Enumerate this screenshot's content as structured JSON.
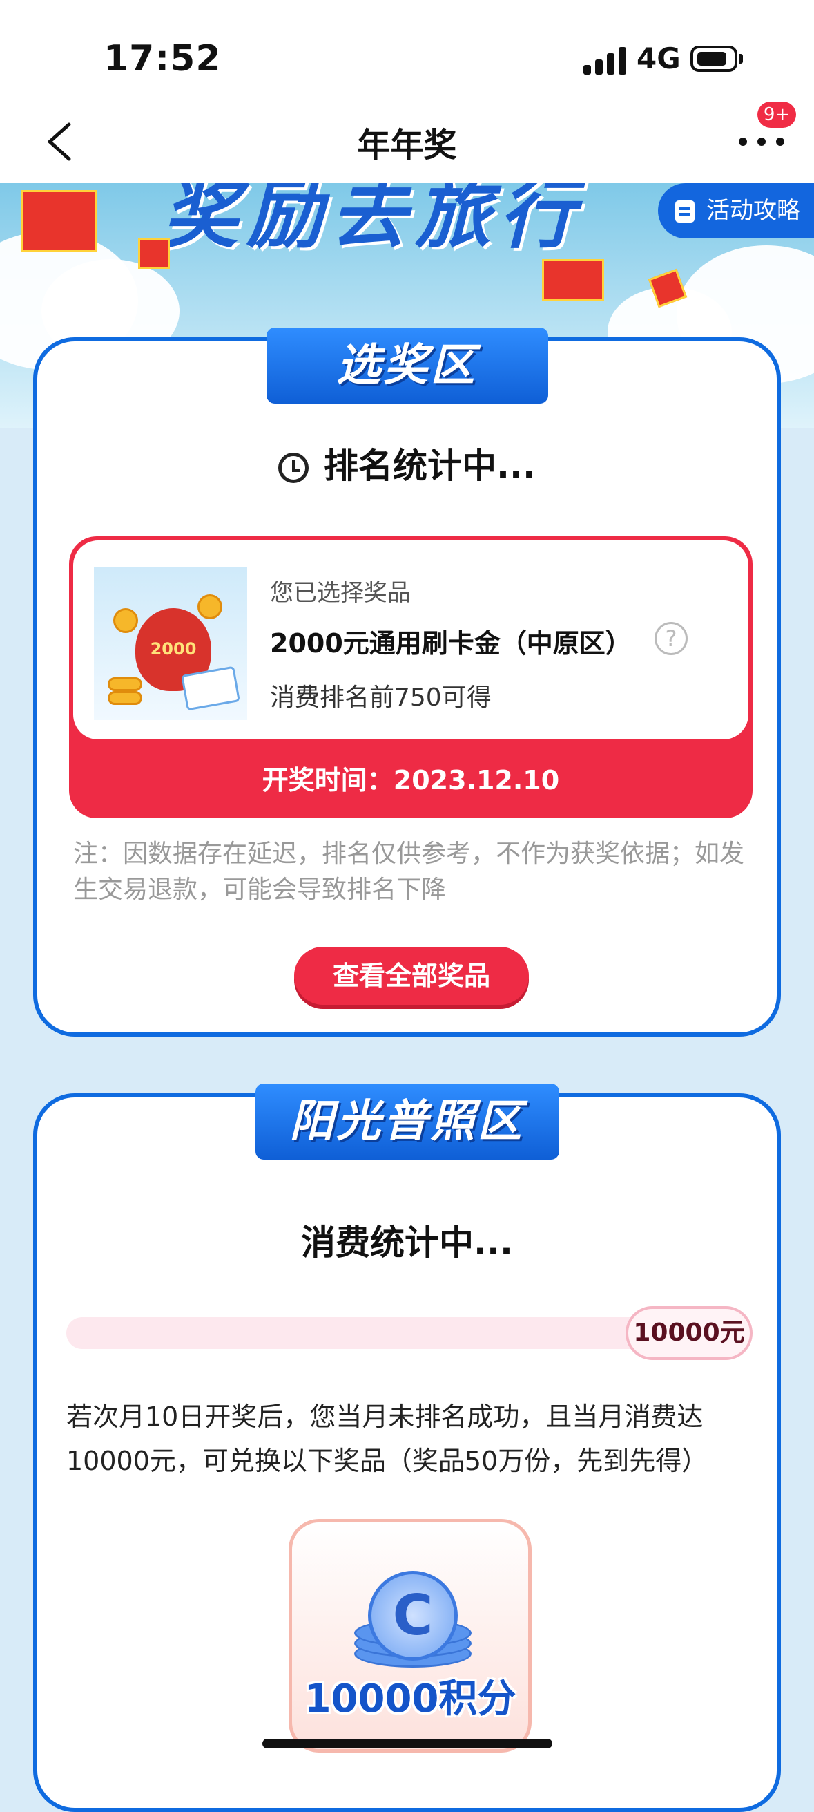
{
  "status_bar": {
    "time": "17:52",
    "network": "4G"
  },
  "nav": {
    "title": "年年奖",
    "badge": "9+"
  },
  "banner": {
    "title": "奖励去旅行",
    "guide_button": "活动攻略"
  },
  "select_zone": {
    "ribbon": "选奖区",
    "status": "排名统计中...",
    "prize": {
      "label": "您已选择奖品",
      "name": "2000元通用刷卡金（中原区）",
      "condition": "消费排名前750可得",
      "image_amount": "2000",
      "help_icon": "question-circle-icon"
    },
    "draw_time": "开奖时间：2023.12.10",
    "note": "注：因数据存在延迟，排名仅供参考，不作为获奖依据；如发生交易退款，可能会导致排名下降",
    "view_all_button": "查看全部奖品"
  },
  "sunshine_zone": {
    "ribbon": "阳光普照区",
    "status": "消费统计中...",
    "progress_target": "10000元",
    "progress_value": 0,
    "description": "若次月10日开奖后，您当月未排名成功，且当月消费达10000元，可兑换以下奖品（奖品50万份，先到先得）",
    "reward_label": "10000积分"
  },
  "colors": {
    "accent_blue": "#0f6be0",
    "accent_red": "#ee2b45",
    "background": "#d8ebf8"
  }
}
